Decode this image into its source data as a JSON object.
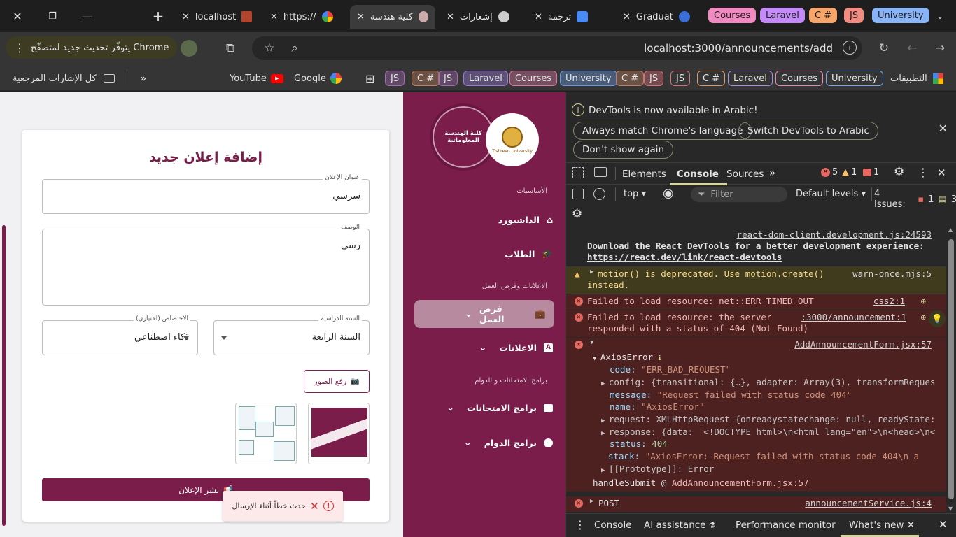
{
  "tabbar": {
    "tabs": [
      {
        "title": "localhost",
        "active": false
      },
      {
        "title": "https://",
        "active": false
      },
      {
        "title": "كلية هندسة",
        "active": true
      },
      {
        "title": "إشعارات",
        "active": false
      },
      {
        "title": "ترجمة",
        "active": false
      },
      {
        "title": "Graduat",
        "active": false
      }
    ],
    "groups": [
      {
        "label": "Courses",
        "color": "#f08ac0"
      },
      {
        "label": "Laravel",
        "color": "#c58af9"
      },
      {
        "label": "C #",
        "color": "#f6a66a"
      },
      {
        "label": "JS",
        "color": "#f28b82"
      },
      {
        "label": "University",
        "color": "#8ab4f8"
      }
    ]
  },
  "toolbar": {
    "update_label": "يتوفّر تحديث جديد لمتصفّح Chrome",
    "url": "localhost:3000/announcements/add"
  },
  "bookmarks": {
    "all_bookmarks": "كل الإشارات المرجعية",
    "youtube": "YouTube",
    "google": "Google",
    "apps": "التطبيقات",
    "folders": [
      {
        "label": "JS",
        "color": "#a36ab3"
      },
      {
        "label": "C #",
        "color": "#c08060"
      },
      {
        "label": "JS",
        "color": "#a36ab3"
      },
      {
        "label": "Laravel",
        "color": "#9a7ad9"
      },
      {
        "label": "Courses",
        "color": "#d97aa5"
      },
      {
        "label": "University",
        "color": "#6a98e0"
      },
      {
        "label": "C #",
        "color": "#c08060"
      },
      {
        "label": "JS",
        "color": "#d9707a"
      },
      {
        "label": "JS",
        "color": "#d9707a"
      },
      {
        "label": "C #",
        "color": "#e09a6a"
      },
      {
        "label": "Laravel",
        "color": "#b08ae8"
      },
      {
        "label": "Courses",
        "color": "#e88ab8"
      },
      {
        "label": "University",
        "color": "#7aa8f0"
      }
    ]
  },
  "form": {
    "title": "إضافة إعلان جديد",
    "title_label": "عنوان الإعلان",
    "title_value": "سرسي",
    "desc_label": "الوصف",
    "desc_value": "رسي",
    "year_label": "السنة الدراسية",
    "year_value": "السنة الرابعة",
    "spec_label": "الاختصاص (اختياري)",
    "spec_value": "ذكاء اصطناعي",
    "upload_label": "رفع الصور",
    "submit_label": "نشر الإعلان",
    "toast": "حدث خطأ أثناء الإرسال"
  },
  "sidebar": {
    "logo_text": "كلية الهندسة المعلوماتية",
    "university_text": "Tishreen University",
    "sec_basics": "الأساسيات",
    "dashboard": "الداشبورد",
    "students": "الطلاب",
    "sec_ads": "الاعلانات وفرص العمل",
    "jobs": "فرص العمل",
    "announcements": "الاعلانات",
    "sec_programs": "برامج الامتحانات و الدوام",
    "exams": "برامج الامتحانات",
    "schedule": "برامج الدوام"
  },
  "devtools": {
    "banner": "DevTools is now available in Arabic!",
    "btn_match": "Always match Chrome's language",
    "btn_switch": "Switch DevTools to Arabic",
    "btn_dont": "Don't show again",
    "tabs": [
      "Elements",
      "Console",
      "Sources"
    ],
    "err_count": "5",
    "warn_count": "1",
    "info_count": "1",
    "context": "top",
    "filter_placeholder": "Filter",
    "levels": "Default levels",
    "issues_label": "4 Issues:",
    "issues_err": "1",
    "issues_info": "3",
    "drawer_tabs": [
      "Console",
      "AI assistance",
      "Performance monitor",
      "What's new"
    ],
    "messages": {
      "m1_src": "react-dom-client.development.js:24593",
      "m1_text": "Download the React DevTools for a better development experience:",
      "m1_link": "https://react.dev/link/react-devtools",
      "m2_text": "motion() is deprecated. Use motion.create()",
      "m2_text2": "instead.",
      "m2_src": "warn-once.mjs:5",
      "m3_text": "Failed to load resource: net::ERR_TIMED_OUT",
      "m3_src": "css2:1",
      "m4_text": "Failed to load resource: the server",
      "m4_text2": "responded with a status of 404 (Not Found)",
      "m4_src": ":3000/announcement:1",
      "m5_src": "AddAnnouncementForm.jsx:57",
      "axios_title": "AxiosError",
      "code_key": "code:",
      "code_val": "\"ERR_BAD_REQUEST\"",
      "config_line": "config: {transitional: {…}, adapter: Array(3), transformReques",
      "message_key": "message:",
      "message_val": "\"Request failed with status code 404\"",
      "name_key": "name:",
      "name_val": "\"AxiosError\"",
      "request_line": "request: XMLHttpRequest {onreadystatechange: null, readyState:",
      "response_line": "response: {data: '<!DOCTYPE html>\\n<html lang=\"en\">\\n<head>\\n<",
      "status_key": "status:",
      "status_val": "404",
      "stack_key": "stack:",
      "stack_val": "\"AxiosError: Request failed with status code 404\\n    a",
      "proto_line": "[[Prototype]]: Error",
      "handle_text": "handleSubmit @",
      "handle_src": "AddAnnouncementForm.jsx:57",
      "post_text": "POST",
      "post_src": "announcementService.js:4"
    }
  }
}
